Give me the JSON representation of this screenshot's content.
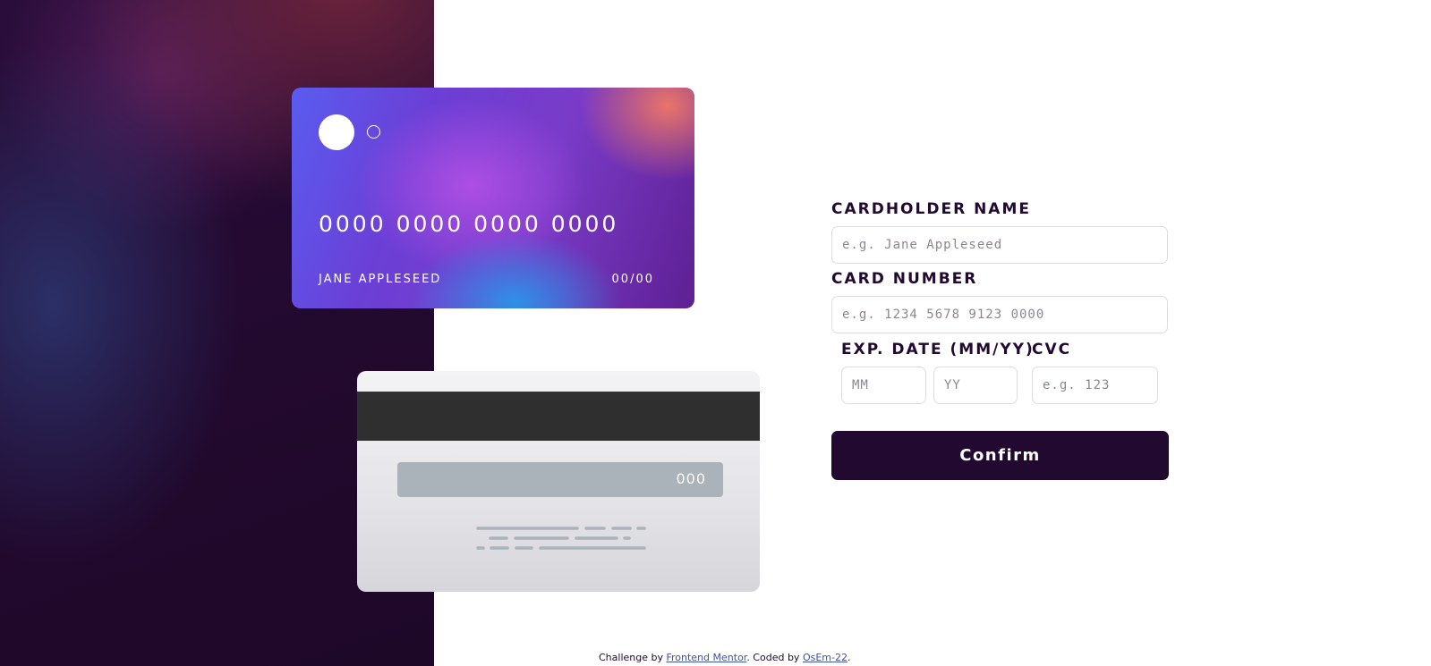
{
  "card_front": {
    "number": "0000 0000 0000 0000",
    "name": "JANE APPLESEED",
    "expiry": "00/00"
  },
  "card_back": {
    "cvc": "000"
  },
  "form": {
    "name_label": "CARDHOLDER NAME",
    "name_placeholder": "e.g. Jane Appleseed",
    "number_label": "CARD NUMBER",
    "number_placeholder": "e.g. 1234 5678 9123 0000",
    "expiry_label": "EXP. DATE (MM/YY)",
    "month_placeholder": "MM",
    "year_placeholder": "YY",
    "cvc_label": "CVC",
    "cvc_placeholder": "e.g. 123",
    "confirm_label": "Confirm"
  },
  "footer": {
    "prefix": "Challenge by",
    "link1": "Frontend Mentor",
    "middle": ". Coded by",
    "link2": "OsEm-22",
    "suffix": "."
  },
  "colors": {
    "dark": "#21092f",
    "link": "#3e52a3",
    "input_border": "#dedddf"
  }
}
